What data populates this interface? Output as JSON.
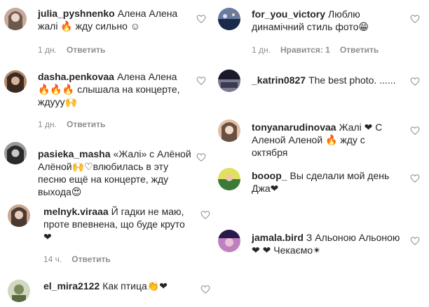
{
  "left": [
    {
      "user": "julia_pyshnenko",
      "text": "Алена Алена жалі 🔥 жду сильно ☺",
      "time": "1 дн.",
      "reply": "Ответить",
      "avatar_colors": [
        "#5a4a42",
        "#c9a99a"
      ]
    },
    {
      "user": "dasha.penkovaa",
      "text": "Алена Алена 🔥🔥🔥 слышала на концерте, ждууу🙌",
      "time": "1 дн.",
      "reply": "Ответить",
      "avatar_colors": [
        "#3b2a20",
        "#b48a6a"
      ]
    },
    {
      "user": "pasieka_masha",
      "text": "«Жалі» с Алёной Алёной🙌♡влюбилась в эту песню ещё на концерте, жду выхода😍",
      "time": "",
      "reply": "",
      "avatar_colors": [
        "#2a2a2a",
        "#9a9a9a"
      ]
    },
    {
      "user": "melnyk.viraaa",
      "text": "Й гадки не маю, проте впевнена, що буде круто ❤",
      "time": "14 ч.",
      "reply": "Ответить",
      "avatar_colors": [
        "#4a3a32",
        "#caa890"
      ]
    },
    {
      "user": "el_mira2122",
      "text": "Как птица👏❤",
      "time": "",
      "reply": "",
      "avatar_colors": [
        "#7a8a5a",
        "#d0d8c0"
      ]
    }
  ],
  "right": [
    {
      "user": "for_you_victory",
      "text": "Люблю динамічний стиль фото😁",
      "time": "1 дн.",
      "likes": "Нравится: 1",
      "reply": "Ответить",
      "avatar_colors": [
        "#1a2a4a",
        "#6a7aa0"
      ]
    },
    {
      "user": "_katrin0827",
      "text": "The best photo. ......",
      "time": "",
      "likes": "",
      "reply": "",
      "avatar_colors": [
        "#1a1a2a",
        "#7a7a90"
      ]
    },
    {
      "user": "tonyanarudinovaa",
      "text": "Жалі ❤ С Аленой Аленой 🔥 жду с октября",
      "time": "",
      "likes": "",
      "reply": "",
      "avatar_colors": [
        "#6a5040",
        "#e0c0a8"
      ]
    },
    {
      "user": "booop_",
      "text": "Вы сделали мой день Джа❤",
      "time": "",
      "likes": "",
      "reply": "",
      "avatar_colors": [
        "#3a7a3a",
        "#e0e060"
      ]
    },
    {
      "user": "jamala.bird",
      "text": "З Альоною Альоною ❤ ❤ Чекаємо✴",
      "time": "",
      "likes": "",
      "reply": "",
      "avatar_colors": [
        "#2a1a4a",
        "#c080c0"
      ]
    }
  ]
}
